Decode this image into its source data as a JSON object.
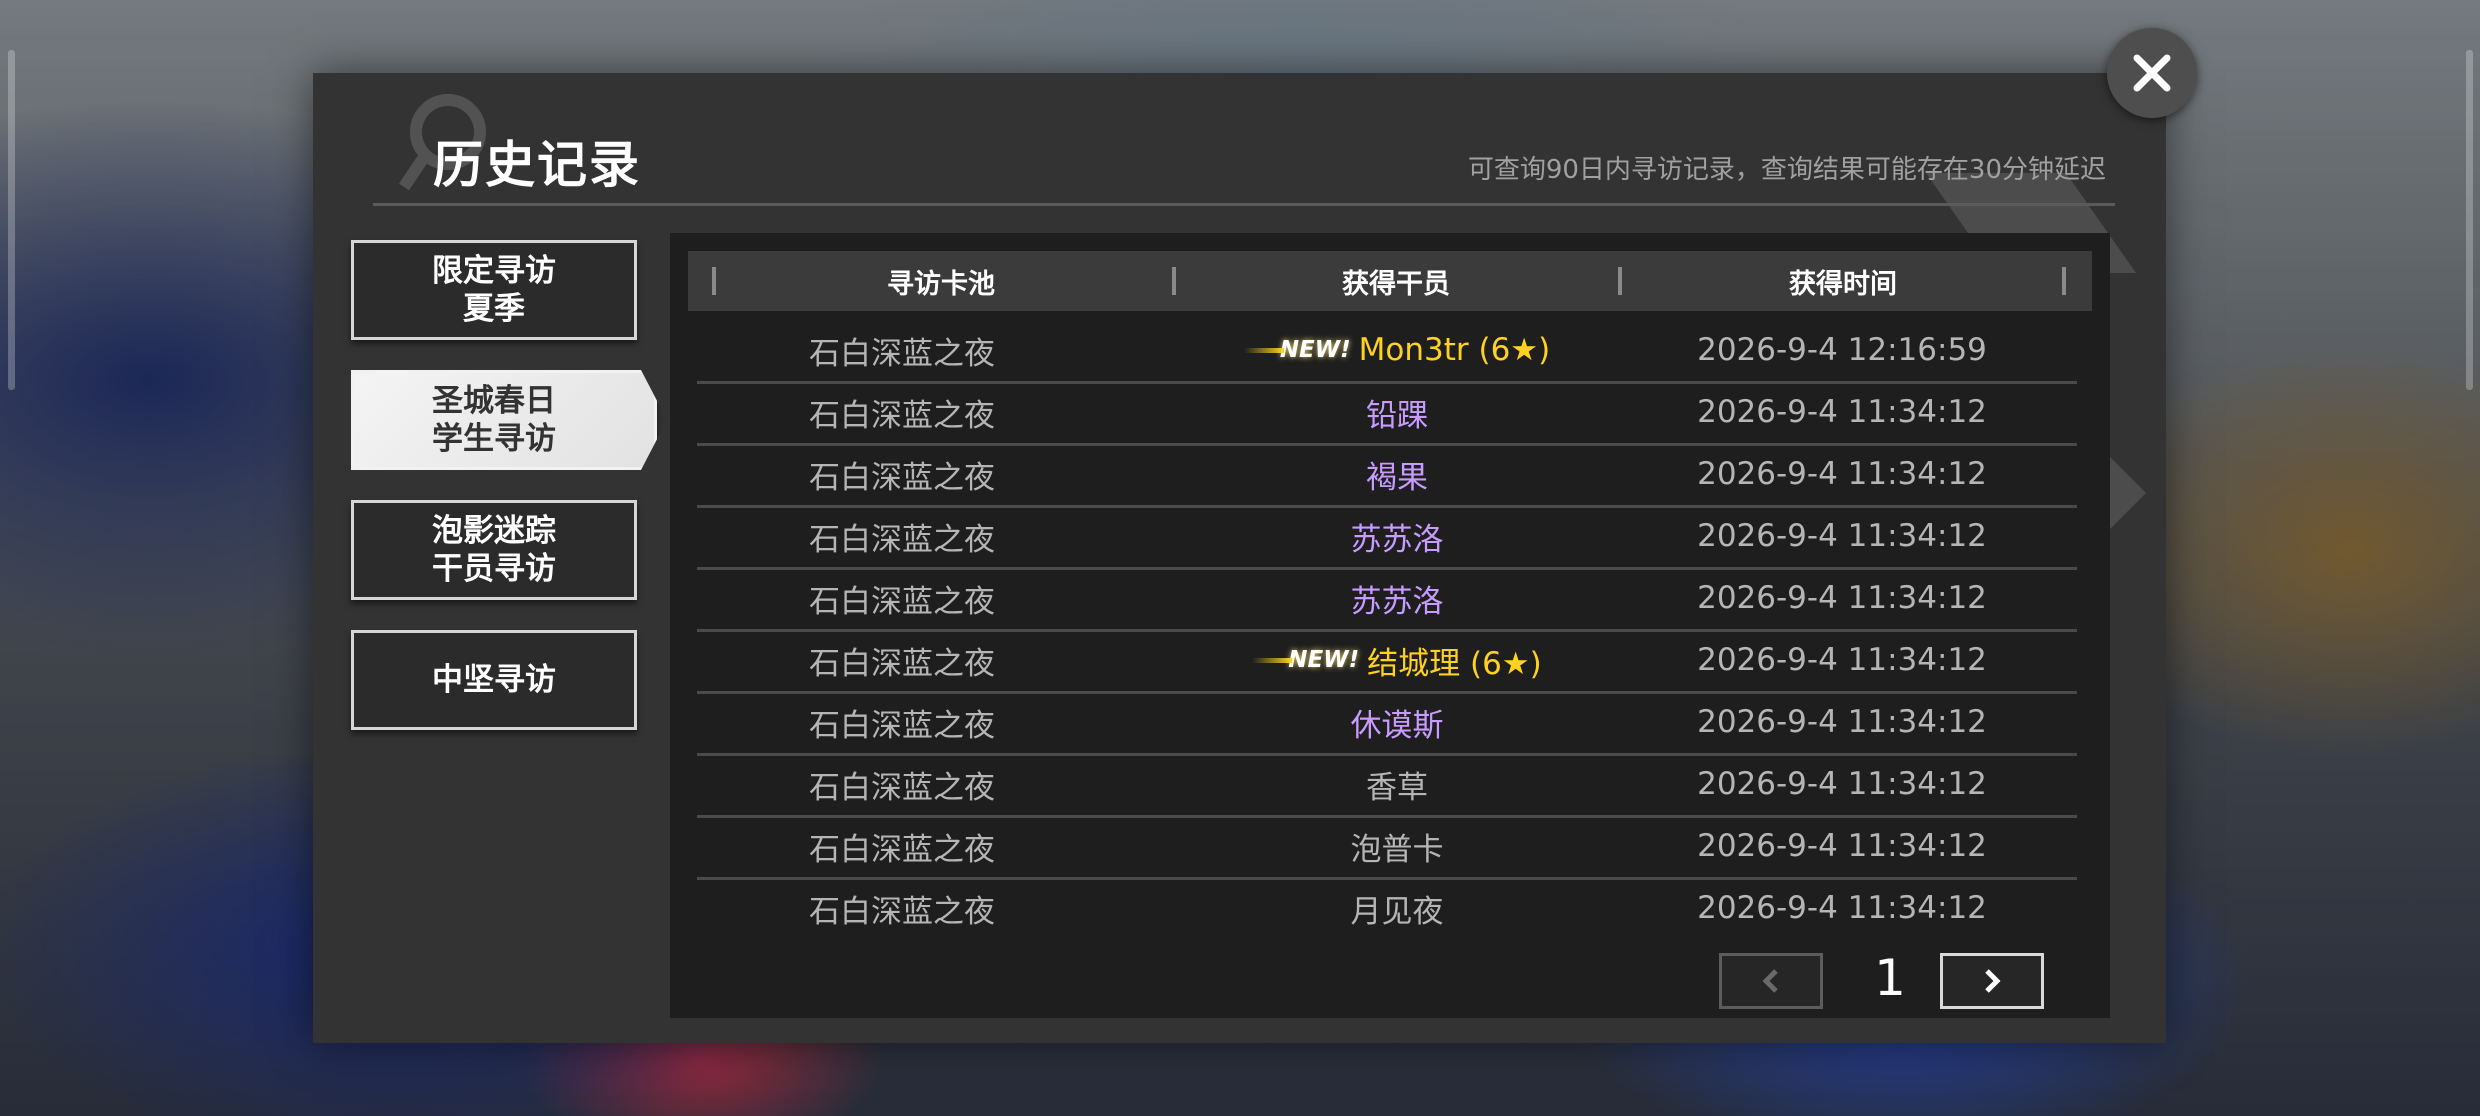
{
  "header": {
    "title": "历史记录",
    "subtitle": "可查询90日内寻访记录，查询结果可能存在30分钟延迟"
  },
  "tabs": [
    {
      "label_line1": "限定寻访",
      "label_line2": "夏季",
      "active": false
    },
    {
      "label_line1": "圣城春日",
      "label_line2": "学生寻访",
      "active": true
    },
    {
      "label_line1": "泡影迷踪",
      "label_line2": "干员寻访",
      "active": false
    },
    {
      "label_line1": "中坚寻访",
      "label_line2": "",
      "active": false
    }
  ],
  "table": {
    "columns": [
      "寻访卡池",
      "获得干员",
      "获得时间"
    ],
    "new_badge": "NEW!",
    "rows": [
      {
        "pool": "石白深蓝之夜",
        "operator": "Mon3tr (6★)",
        "time": "2026-9-4 12:16:59",
        "rarity": "gold",
        "is_new": true
      },
      {
        "pool": "石白深蓝之夜",
        "operator": "铅踝",
        "time": "2026-9-4 11:34:12",
        "rarity": "purple",
        "is_new": false
      },
      {
        "pool": "石白深蓝之夜",
        "operator": "褐果",
        "time": "2026-9-4 11:34:12",
        "rarity": "purple",
        "is_new": false
      },
      {
        "pool": "石白深蓝之夜",
        "operator": "苏苏洛",
        "time": "2026-9-4 11:34:12",
        "rarity": "purple",
        "is_new": false
      },
      {
        "pool": "石白深蓝之夜",
        "operator": "苏苏洛",
        "time": "2026-9-4 11:34:12",
        "rarity": "purple",
        "is_new": false
      },
      {
        "pool": "石白深蓝之夜",
        "operator": "结城理 (6★)",
        "time": "2026-9-4 11:34:12",
        "rarity": "gold",
        "is_new": true
      },
      {
        "pool": "石白深蓝之夜",
        "operator": "休谟斯",
        "time": "2026-9-4 11:34:12",
        "rarity": "purple",
        "is_new": false
      },
      {
        "pool": "石白深蓝之夜",
        "operator": "香草",
        "time": "2026-9-4 11:34:12",
        "rarity": "white",
        "is_new": false
      },
      {
        "pool": "石白深蓝之夜",
        "operator": "泡普卡",
        "time": "2026-9-4 11:34:12",
        "rarity": "white",
        "is_new": false
      },
      {
        "pool": "石白深蓝之夜",
        "operator": "月见夜",
        "time": "2026-9-4 11:34:12",
        "rarity": "white",
        "is_new": false
      }
    ]
  },
  "pager": {
    "page": "1",
    "prev_icon": "chevron-left-icon",
    "next_icon": "chevron-right-icon"
  },
  "close_icon": "close-icon",
  "colors": {
    "gold": "#ffd21f",
    "purple": "#c79bff",
    "white": "#b5b5b5",
    "panel": "#333333"
  }
}
